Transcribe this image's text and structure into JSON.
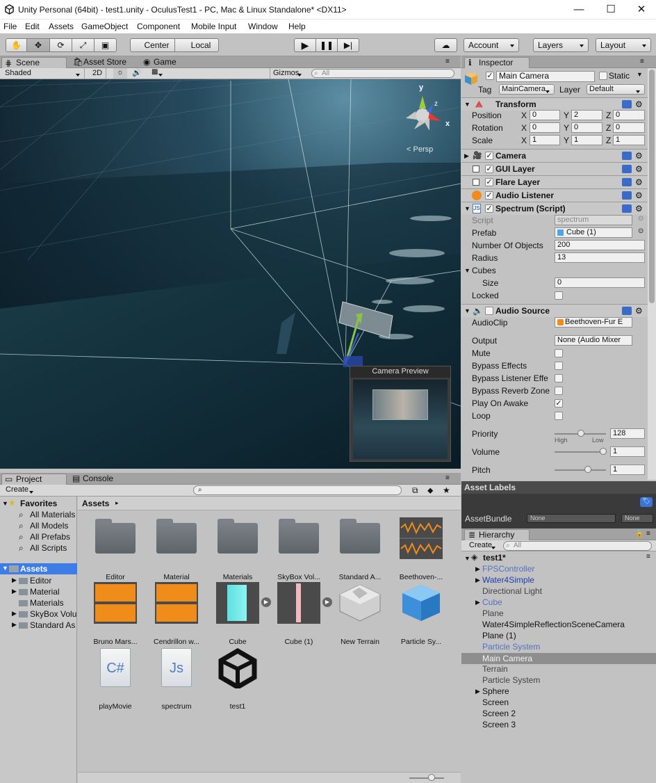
{
  "titlebar": {
    "title": "Unity Personal (64bit) - test1.unity - OculusTest1 - PC, Mac & Linux Standalone* <DX11>",
    "minimize": "—",
    "maximize": "☐",
    "close": "✕"
  },
  "menu": [
    "File",
    "Edit",
    "Assets",
    "GameObject",
    "Component",
    "Mobile Input",
    "Window",
    "Help"
  ],
  "toolbar": {
    "pivot": "Center",
    "space": "Local",
    "account": "Account",
    "layers": "Layers",
    "layout": "Layout"
  },
  "scene_tabs": {
    "scene": "Scene",
    "asset_store": "Asset Store",
    "game": "Game"
  },
  "scene_bar": {
    "shading": "Shaded",
    "mode2d": "2D",
    "gizmos": "Gizmos",
    "search_placeholder": "All"
  },
  "scene": {
    "persp": "Persp",
    "gizmo_x": "x",
    "gizmo_y": "y",
    "gizmo_z": "z",
    "camera_preview": "Camera Preview"
  },
  "inspector": {
    "tab": "Inspector",
    "object_name": "Main Camera",
    "static": "Static",
    "tag_label": "Tag",
    "tag": "MainCamera",
    "layer_label": "Layer",
    "layer": "Default",
    "transform": {
      "title": "Transform",
      "position_label": "Position",
      "rotation_label": "Rotation",
      "scale_label": "Scale",
      "position": [
        "0",
        "2",
        "0"
      ],
      "rotation": [
        "0",
        "0",
        "0"
      ],
      "scale": [
        "1",
        "1",
        "1"
      ],
      "x": "X",
      "y": "Y",
      "z": "Z"
    },
    "components": [
      "Camera",
      "GUI Layer",
      "Flare Layer",
      "Audio Listener"
    ],
    "spectrum": {
      "title": "Spectrum (Script)",
      "script_label": "Script",
      "script": "spectrum",
      "prefab_label": "Prefab",
      "prefab": "Cube (1)",
      "num_label": "Number Of Objects",
      "num": "200",
      "radius_label": "Radius",
      "radius": "13",
      "cubes_label": "Cubes",
      "size_label": "Size",
      "size": "0",
      "locked_label": "Locked"
    },
    "audio": {
      "title": "Audio Source",
      "clip_label": "AudioClip",
      "clip": "Beethoven-Fur E",
      "output_label": "Output",
      "output": "None (Audio Mixer",
      "mute": "Mute",
      "bypass_effects": "Bypass Effects",
      "bypass_listener": "Bypass Listener Effe",
      "bypass_reverb": "Bypass Reverb Zone",
      "play_on_awake": "Play On Awake",
      "loop": "Loop",
      "priority_label": "Priority",
      "priority": "128",
      "high": "High",
      "low": "Low",
      "volume_label": "Volume",
      "volume": "1",
      "pitch_label": "Pitch",
      "pitch": "1"
    }
  },
  "asset_labels": {
    "title": "Asset Labels",
    "bundle_label": "AssetBundle",
    "bundle": "None",
    "variant": "None"
  },
  "project": {
    "tab": "Project",
    "console_tab": "Console",
    "create": "Create",
    "favorites": "Favorites",
    "fav_items": [
      "All Materials",
      "All Models",
      "All Prefabs",
      "All Scripts"
    ],
    "assets_root": "Assets",
    "asset_folders": [
      "Editor",
      "Material",
      "Materials",
      "SkyBox Volu",
      "Standard As"
    ],
    "breadcrumb": "Assets",
    "grid": [
      "Editor",
      "Material",
      "Materials",
      "SkyBox Vol...",
      "Standard A...",
      "Beethoven-...",
      "Bruno Mars...",
      "Cendrillon w...",
      "Cube",
      "Cube (1)",
      "New Terrain",
      "Particle Sy...",
      "playMovie",
      "spectrum",
      "test1"
    ]
  },
  "hierarchy": {
    "tab": "Hierarchy",
    "create": "Create",
    "search_placeholder": "All",
    "scene": "test1*",
    "items": [
      "FPSController",
      "Water4Simple",
      "Directional Light",
      "Cube",
      "Plane",
      "Water4SimpleReflectionSceneCamera",
      "Plane (1)",
      "Particle System",
      "Main Camera",
      "Terrain",
      "Particle System",
      "Sphere",
      "Screen",
      "Screen 2",
      "Screen 3"
    ]
  },
  "colors": {
    "toolbar_bg": "#c2c2c2",
    "selection": "#3e7de7",
    "hier_selected": "#8e8e8e",
    "prefab_blue": "#1d3ea8",
    "orange": "#f08c1a"
  }
}
